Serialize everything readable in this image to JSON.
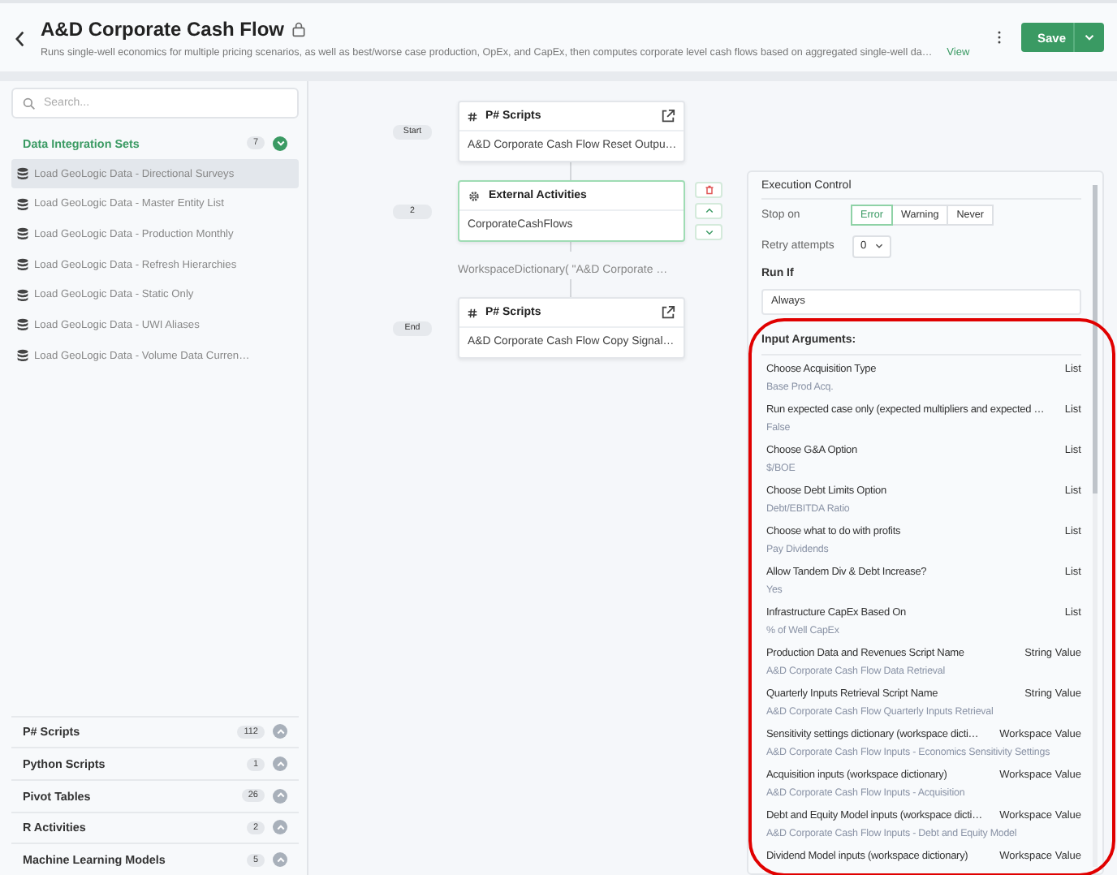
{
  "header": {
    "title": "A&D Corporate Cash Flow",
    "description": "Runs single-well economics for multiple pricing scenarios, as well as best/worse case production, OpEx, and CapEx, then computes corporate level cash flows based on aggregated single-well da…",
    "view_link": "View",
    "save_button": "Save"
  },
  "sidebar": {
    "search": {
      "placeholder": "Search..."
    },
    "sections": [
      {
        "title": "Data Integration Sets",
        "count": "7",
        "expanded": true,
        "items": [
          {
            "label": "Load GeoLogic Data - Directional Surveys",
            "selected": true
          },
          {
            "label": "Load GeoLogic Data - Master Entity List",
            "selected": false
          },
          {
            "label": "Load GeoLogic Data - Production Monthly",
            "selected": false
          },
          {
            "label": "Load GeoLogic Data - Refresh Hierarchies",
            "selected": false
          },
          {
            "label": "Load GeoLogic Data - Static Only",
            "selected": false
          },
          {
            "label": "Load GeoLogic Data - UWI Aliases",
            "selected": false
          },
          {
            "label": "Load GeoLogic Data - Volume Data Curren…",
            "selected": false
          }
        ]
      },
      {
        "title": "P# Scripts",
        "count": "112",
        "expanded": false
      },
      {
        "title": "Python Scripts",
        "count": "1",
        "expanded": false
      },
      {
        "title": "Pivot Tables",
        "count": "26",
        "expanded": false
      },
      {
        "title": "R Activities",
        "count": "2",
        "expanded": false
      },
      {
        "title": "Machine Learning Models",
        "count": "5",
        "expanded": false
      }
    ]
  },
  "flow": {
    "steps": [
      {
        "label": "Start",
        "kind": "script",
        "title": "P# Scripts",
        "body": "A&D Corporate Cash Flow Reset Outpu…",
        "selected": false
      },
      {
        "label": "2",
        "kind": "external",
        "title": "External Activities",
        "body": "CorporateCashFlows",
        "selected": true,
        "note": "WorkspaceDictionary( \"A&D Corporate …"
      },
      {
        "label": "End",
        "kind": "script",
        "title": "P# Scripts",
        "body": "A&D Corporate Cash Flow Copy Signal…",
        "selected": false
      }
    ]
  },
  "execution_control": {
    "title": "Execution Control",
    "stop_on_label": "Stop on",
    "stop_on": [
      {
        "label": "Error",
        "selected": true
      },
      {
        "label": "Warning",
        "selected": false
      },
      {
        "label": "Never",
        "selected": false
      }
    ],
    "retry_label": "Retry attempts",
    "retry_value": "0",
    "run_if_label": "Run If",
    "run_if_value": "Always"
  },
  "input_arguments": {
    "title": "Input Arguments:",
    "items": [
      {
        "name": "Choose Acquisition Type",
        "type": "List",
        "value": "Base Prod Acq."
      },
      {
        "name": "Run expected case only (expected multipliers and expected …",
        "type": "List",
        "value": "False"
      },
      {
        "name": "Choose G&A Option",
        "type": "List",
        "value": "$/BOE"
      },
      {
        "name": "Choose Debt Limits Option",
        "type": "List",
        "value": "Debt/EBITDA Ratio"
      },
      {
        "name": "Choose what to do with profits",
        "type": "List",
        "value": "Pay Dividends"
      },
      {
        "name": "Allow Tandem Div & Debt Increase?",
        "type": "List",
        "value": "Yes"
      },
      {
        "name": "Infrastructure CapEx Based On",
        "type": "List",
        "value": "% of Well CapEx"
      },
      {
        "name": "Production Data and Revenues Script Name",
        "type": "String Value",
        "value": "A&D Corporate Cash Flow Data Retrieval"
      },
      {
        "name": "Quarterly Inputs Retrieval Script Name",
        "type": "String Value",
        "value": "A&D Corporate Cash Flow Quarterly Inputs Retrieval"
      },
      {
        "name": "Sensitivity settings dictionary (workspace dicti…",
        "type": "Workspace Value",
        "value": "A&D Corporate Cash Flow Inputs - Economics Sensitivity Settings"
      },
      {
        "name": "Acquisition inputs (workspace dictionary)",
        "type": "Workspace Value",
        "value": "A&D Corporate Cash Flow Inputs - Acquisition"
      },
      {
        "name": "Debt and Equity Model inputs (workspace dicti…",
        "type": "Workspace Value",
        "value": "A&D Corporate Cash Flow Inputs - Debt and Equity Model"
      },
      {
        "name": "Dividend Model inputs (workspace dictionary)",
        "type": "Workspace Value"
      }
    ]
  }
}
